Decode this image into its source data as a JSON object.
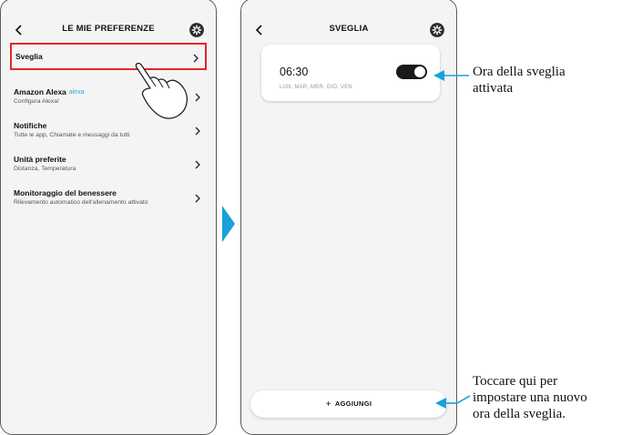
{
  "left_screen": {
    "title": "LE MIE PREFERENZE",
    "items": [
      {
        "label": "Sveglia",
        "sub": ""
      },
      {
        "label": "Amazon Alexa",
        "sub": "Configura Alexa!",
        "logo": "alexa"
      },
      {
        "label": "Notifiche",
        "sub": "Tutte le app, Chiamate e messaggi da tutti"
      },
      {
        "label": "Unità preferite",
        "sub": "Distanza, Temperatura"
      },
      {
        "label": "Monitoraggio del benessere",
        "sub": "Rilevamento automatico dell'allenamento attivato"
      }
    ]
  },
  "right_screen": {
    "title": "SVEGLIA",
    "alarm": {
      "time": "06:30",
      "days": "LUN, MAR, MER, GIO, VEN",
      "enabled": true
    },
    "add_button": {
      "icon": "+",
      "label": "AGGIUNGI"
    }
  },
  "callouts": [
    {
      "line1": "Ora della sveglia",
      "line2": "attivata"
    },
    {
      "line1": "Toccare qui per",
      "line2": "impostare una nuovo",
      "line3": "ora della sveglia."
    }
  ],
  "colors": {
    "highlight": "#e4252d",
    "callout_blue": "#1aa0dc",
    "toggle_on": "#1a1a1a"
  },
  "icons": [
    "chevron-left-icon",
    "gear-icon",
    "chevron-right-icon",
    "hand-pointer-icon",
    "arrow-right-triangle-icon",
    "plus-icon"
  ]
}
